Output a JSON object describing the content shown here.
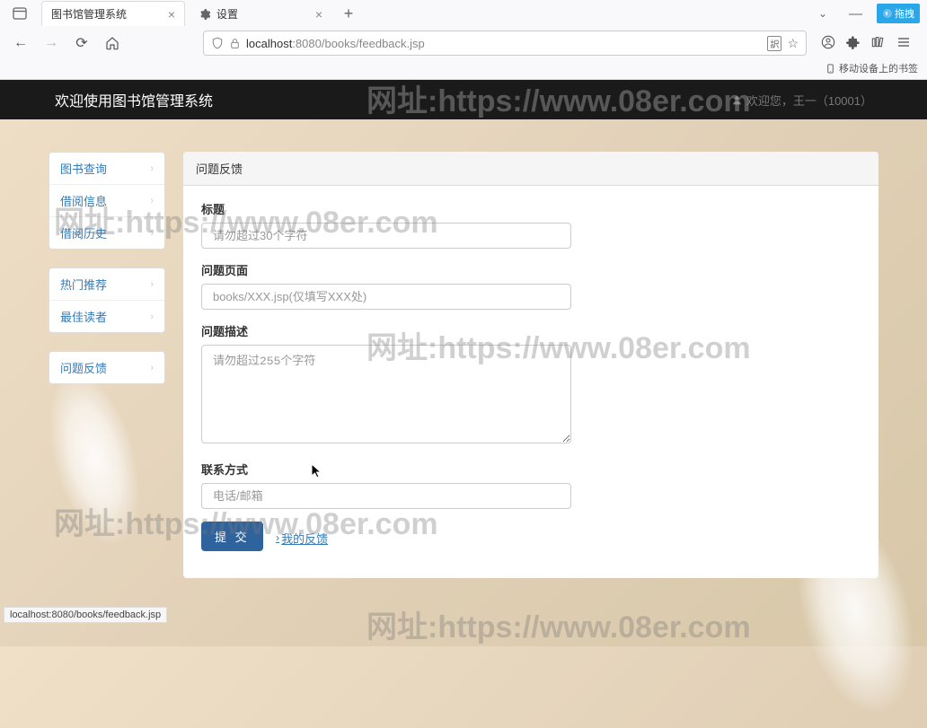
{
  "browser": {
    "tab1": "图书馆管理系统",
    "tab2": "设置",
    "url_host": "localhost",
    "url_port": ":8080",
    "url_path": "/books/feedback.jsp",
    "bookmark_label": "移动设备上的书签",
    "ext_label": "拖拽"
  },
  "header": {
    "brand": "欢迎使用图书馆管理系统",
    "welcome": "欢迎您，王一（10001）"
  },
  "sidebar": {
    "group1": [
      "图书查询",
      "借阅信息",
      "借阅历史"
    ],
    "group2": [
      "热门推荐",
      "最佳读者"
    ],
    "group3": [
      "问题反馈"
    ]
  },
  "form": {
    "panel_title": "问题反馈",
    "labels": {
      "title": "标题",
      "page": "问题页面",
      "desc": "问题描述",
      "contact": "联系方式"
    },
    "placeholders": {
      "title": "请勿超过30个字符",
      "page": "books/XXX.jsp(仅填写XXX处)",
      "desc": "请勿超过255个字符",
      "contact": "电话/邮箱"
    },
    "submit_label": "提 交",
    "my_feedback": "我的反馈"
  },
  "status_bar": "localhost:8080/books/feedback.jsp",
  "watermark": "网址:https://www.08er.com"
}
